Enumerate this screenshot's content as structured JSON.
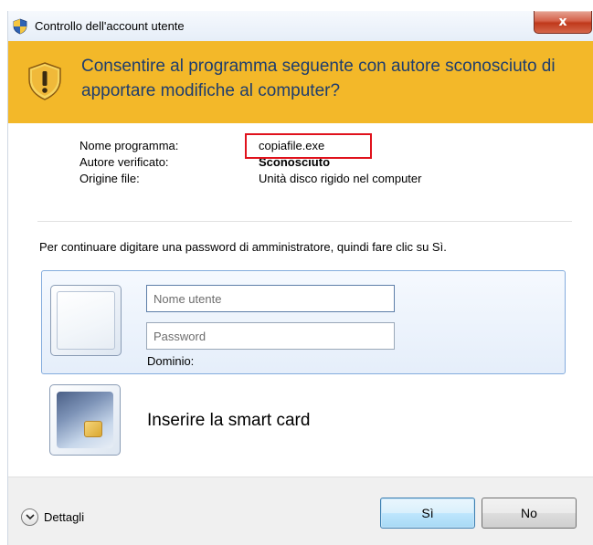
{
  "window": {
    "title": "Controllo dell'account utente",
    "close_label": "x"
  },
  "header": {
    "question": "Consentire al programma seguente con autore sconosciuto di apportare modifiche al computer?"
  },
  "program_info": {
    "name_label": "Nome programma:",
    "name_value": "copiafile.exe",
    "publisher_label": "Autore verificato:",
    "publisher_value": "Sconosciuto",
    "origin_label": "Origine file:",
    "origin_value": "Unità disco rigido nel computer"
  },
  "instruction": "Per continuare digitare una password di amministratore, quindi fare clic su Sì.",
  "credentials": {
    "username_placeholder": "Nome utente",
    "password_placeholder": "Password",
    "domain_label": "Dominio:"
  },
  "smart_card": {
    "label": "Inserire la smart card"
  },
  "footer": {
    "details_label": "Dettagli",
    "yes_label": "Sì",
    "no_label": "No"
  },
  "colors": {
    "header_band": "#f3b829",
    "header_text": "#1e3d6e",
    "highlight_border": "#e0121c",
    "close_button": "#c0391b"
  }
}
